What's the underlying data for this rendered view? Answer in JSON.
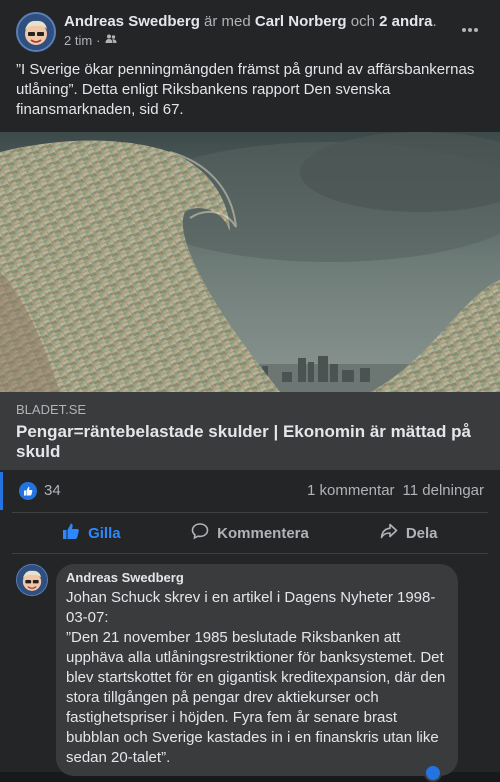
{
  "post": {
    "author": "Andreas Swedberg",
    "with_text": "är med",
    "tagged": "Carl Norberg",
    "and_text": "och",
    "others": "2 andra",
    "period": ".",
    "time": "2 tim",
    "separator": "·",
    "audience_icon": "friends-icon",
    "more_icon": "more-horizontal-icon",
    "text": "”I Sverige ökar penningmängden främst på grund av affärsbankernas utlåning”. Detta enligt Riksbankens rapport Den svenska finansmarknaden, sid 67."
  },
  "link": {
    "domain": "BLADET.SE",
    "title": "Pengar=räntebelastade skulder | Ekonomin är mättad på skuld"
  },
  "stats": {
    "likes": "34",
    "comments": "1 kommentar",
    "shares": "11 delningar"
  },
  "actions": {
    "like": "Gilla",
    "comment": "Kommentera",
    "share": "Dela"
  },
  "comment": {
    "author": "Andreas Swedberg",
    "text": "Johan Schuck skrev i en artikel i Dagens Nyheter 1998-03-07:\n”Den 21 november 1985 beslutade Riksbanken att upphäva alla utlåningsrestriktioner för banksystemet. Det blev startskottet för en gigantisk kreditexpansion, där den stora tillgången på pengar drev aktiekurser och fastighetspriser i höjden. Fyra fem år senare brast bubblan och Sverige kastades in i en finanskris utan like sedan 20-talet”."
  },
  "colors": {
    "background": "#242526",
    "accent": "#2d88ff",
    "link_meta_bg": "#3a3b3c"
  }
}
